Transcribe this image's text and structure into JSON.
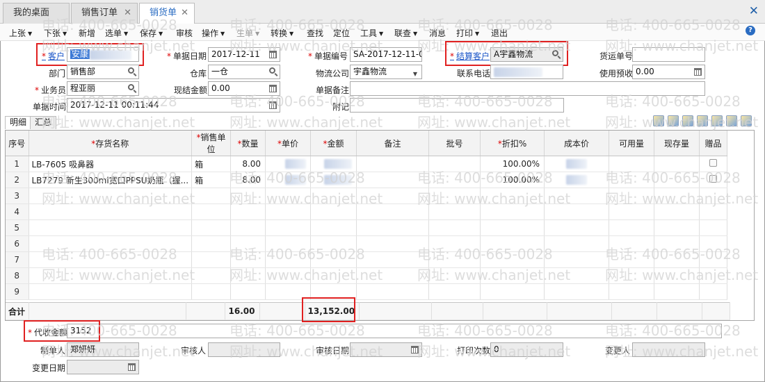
{
  "tabs": [
    {
      "label": "我的桌面",
      "closable": false,
      "active": false
    },
    {
      "label": "销售订单",
      "closable": true,
      "active": false
    },
    {
      "label": "销货单",
      "closable": true,
      "active": true
    }
  ],
  "window_close": "✕",
  "toolbar": {
    "items": [
      {
        "label": "上张",
        "dropdown": true,
        "disabled": false
      },
      {
        "label": "下张",
        "dropdown": true,
        "disabled": false
      },
      {
        "label": "新增",
        "dropdown": false,
        "disabled": false
      },
      {
        "label": "选单",
        "dropdown": true,
        "disabled": false
      },
      {
        "label": "保存",
        "dropdown": true,
        "disabled": false
      },
      {
        "label": "审核",
        "dropdown": false,
        "disabled": false
      },
      {
        "label": "操作",
        "dropdown": true,
        "disabled": false
      },
      {
        "label": "生单",
        "dropdown": true,
        "disabled": true
      },
      {
        "label": "转换",
        "dropdown": true,
        "disabled": false
      },
      {
        "label": "查找",
        "dropdown": false,
        "disabled": false
      },
      {
        "label": "定位",
        "dropdown": false,
        "disabled": false
      },
      {
        "label": "工具",
        "dropdown": true,
        "disabled": false
      },
      {
        "label": "联查",
        "dropdown": true,
        "disabled": false
      },
      {
        "label": "消息",
        "dropdown": false,
        "disabled": false
      },
      {
        "label": "打印",
        "dropdown": true,
        "disabled": false
      },
      {
        "label": "退出",
        "dropdown": false,
        "disabled": false
      }
    ],
    "help_icon": "?"
  },
  "form": {
    "customer_label": "客户",
    "customer_value": "安康",
    "doc_date_label": "单据日期",
    "doc_date_value": "2017-12-11",
    "doc_no_label": "单据编号",
    "doc_no_value": "SA-2017-12-11-0...",
    "settle_customer_label": "结算客户",
    "settle_customer_value": "A宇鑫物流",
    "ship_no_label": "货运单号",
    "ship_no_value": "",
    "dept_label": "部门",
    "dept_value": "销售部",
    "warehouse_label": "仓库",
    "warehouse_value": "一仓",
    "logistics_label": "物流公司",
    "logistics_value": "宇鑫物流",
    "phone_label": "联系电话",
    "phone_value": "",
    "prepay_label": "使用预收",
    "prepay_value": "0.00",
    "sales_label": "业务员",
    "sales_value": "程亚丽",
    "cash_label": "现结金额",
    "cash_value": "0.00",
    "memo_label": "单据备注",
    "memo_value": "",
    "time_label": "单据时间",
    "time_value": "2017-12-11 00:11:44",
    "attach_label": "附记",
    "attach_value": ""
  },
  "detail_tabs": [
    "明细",
    "汇总"
  ],
  "grid": {
    "columns": [
      "序号",
      "存货名称",
      "销售单位",
      "数量",
      "单价",
      "金额",
      "备注",
      "批号",
      "折扣%",
      "成本价",
      "可用量",
      "现存量",
      "赠品"
    ],
    "required": [
      false,
      true,
      true,
      true,
      true,
      true,
      false,
      false,
      true,
      false,
      false,
      false,
      false
    ],
    "rows": [
      {
        "no": "1",
        "name": "LB-7605 吸鼻器",
        "unit": "箱",
        "qty": "8.00",
        "discount": "100.00%"
      },
      {
        "no": "2",
        "name": "LB7279 新生300ml宽口PPSU奶瓶（握...",
        "unit": "箱",
        "qty": "8.00",
        "discount": "100.00%"
      },
      {
        "no": "3"
      },
      {
        "no": "4"
      },
      {
        "no": "5"
      },
      {
        "no": "6"
      },
      {
        "no": "7"
      },
      {
        "no": "8"
      },
      {
        "no": "9"
      }
    ],
    "sum_label": "合计",
    "sum_qty": "16.00",
    "sum_amount": "13,152.00"
  },
  "footer": {
    "collect_label": "代收金额",
    "collect_value": "3152",
    "maker_label": "制单人",
    "maker_value": "郑妍妍",
    "auditor_label": "审核人",
    "auditor_value": "",
    "audit_date_label": "审核日期",
    "audit_date_value": "",
    "print_count_label": "打印次数",
    "print_count_value": "0",
    "changer_label": "变更人",
    "changer_value": "",
    "change_date_label": "变更日期",
    "change_date_value": ""
  },
  "watermark": {
    "line1": "电话: 400-665-0028",
    "line2": "网址: www.chanjet.net"
  },
  "colors": {
    "accent": "#2a6cc2",
    "required": "#d00000",
    "highlight_box": "#e02020"
  }
}
